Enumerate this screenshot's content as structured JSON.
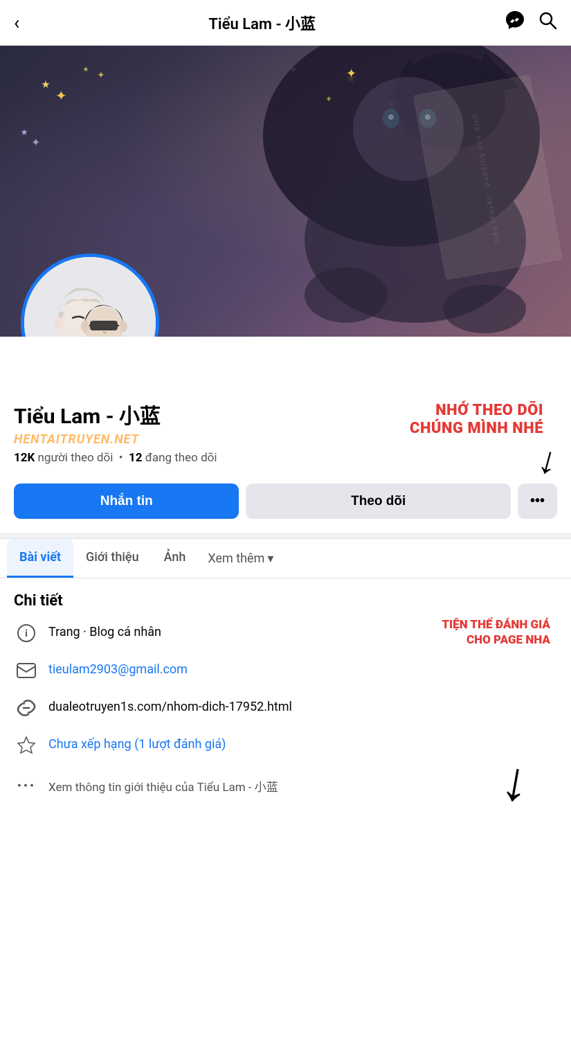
{
  "topNav": {
    "title": "Tiểu Lam - 小蓝",
    "backLabel": "‹",
    "messengerIcon": "messenger",
    "searchIcon": "search"
  },
  "coverPhoto": {
    "bookText": "tiểu thuyết · pudding sóa dịch"
  },
  "profile": {
    "name": "Tiểu Lam - 小蓝",
    "watermark": "HENTAITRUYEN.NET",
    "followersCount": "12K",
    "followersLabel": "người theo dõi",
    "followingCount": "12",
    "followingLabel": "đang theo dõi",
    "promoText1": "NHỚ THEO DÕI",
    "promoText2": "CHÚNG MÌNH NHÉ"
  },
  "buttons": {
    "message": "Nhắn tin",
    "follow": "Theo dõi",
    "more": "•••"
  },
  "tabs": [
    {
      "label": "Bài viết",
      "active": true
    },
    {
      "label": "Giới thiệu",
      "active": false
    },
    {
      "label": "Ảnh",
      "active": false
    },
    {
      "label": "Xem thêm",
      "active": false,
      "hasArrow": true
    }
  ],
  "details": {
    "title": "Chi tiết",
    "rows": [
      {
        "icon": "ℹ",
        "text": "Trang · Blog cá nhân",
        "isBlue": false,
        "promoText1": "TIỆN THỂ ĐÁNH GIÁ",
        "promoText2": "CHO PAGE NHA"
      },
      {
        "icon": "✉",
        "text": "tieulam2903@gmail.com",
        "isBlue": true
      },
      {
        "icon": "🔗",
        "text": "dualeotruyen1s.com/nhom-dich-17952.html",
        "isBlue": false
      },
      {
        "icon": "⭐",
        "text": "Chưa xếp hạng (1 lượt đánh giá)",
        "isBlue": true,
        "hasArrow": true
      }
    ],
    "lastRow": {
      "icon": "•••",
      "text": "Xem thông tin giới thiệu của Tiểu Lam - 小蓝"
    }
  }
}
